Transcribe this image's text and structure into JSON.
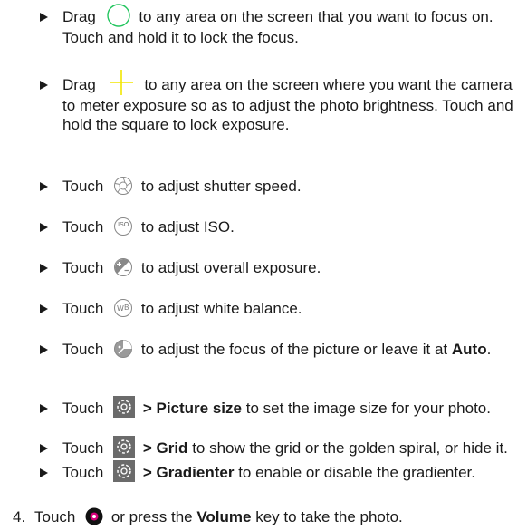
{
  "bullets": [
    {
      "a": "Drag",
      "b": "to any area on the screen that you want to focus on. Touch and hold it to lock the focus."
    },
    {
      "a": "Drag",
      "b": "to any area on the screen where you want the camera to meter exposure so as to adjust the photo brightness. Touch and hold the square to lock exposure."
    },
    {
      "a": "Touch",
      "b": "to adjust shutter speed."
    },
    {
      "a": "Touch",
      "b": "to adjust ISO."
    },
    {
      "a": "Touch",
      "b": "to adjust overall exposure."
    },
    {
      "a": "Touch",
      "b": "to adjust white balance."
    },
    {
      "a": "Touch",
      "b": "to adjust the focus of the picture or leave it at",
      "bold": "Auto",
      "tail": "."
    },
    {
      "a": "Touch",
      "bold": "> Picture size",
      "b": "to set the image size for your photo."
    },
    {
      "a": "Touch",
      "bold": "> Grid",
      "b": "to show the grid or the golden spiral, or hide it."
    },
    {
      "a": "Touch",
      "bold": "> Gradienter",
      "b": "to enable or disable the gradienter."
    }
  ],
  "step": {
    "number": "4.",
    "a": "Touch",
    "b": "or press the",
    "bold": "Volume",
    "c": "key to take the photo."
  },
  "icons": {
    "focus_circle": "focus-circle-icon",
    "exposure_cross": "exposure-crosshair-icon",
    "shutter": "shutter-speed-icon",
    "iso": "iso-icon",
    "exposure": "exposure-compensation-icon",
    "white_balance": "white-balance-icon",
    "focus": "focus-adjust-icon",
    "settings": "settings-gear-icon",
    "capture": "shutter-button-icon",
    "iso_text": "ISO",
    "wb_text": "B",
    "green": "#22c55e",
    "yellow": "#f2e600"
  }
}
